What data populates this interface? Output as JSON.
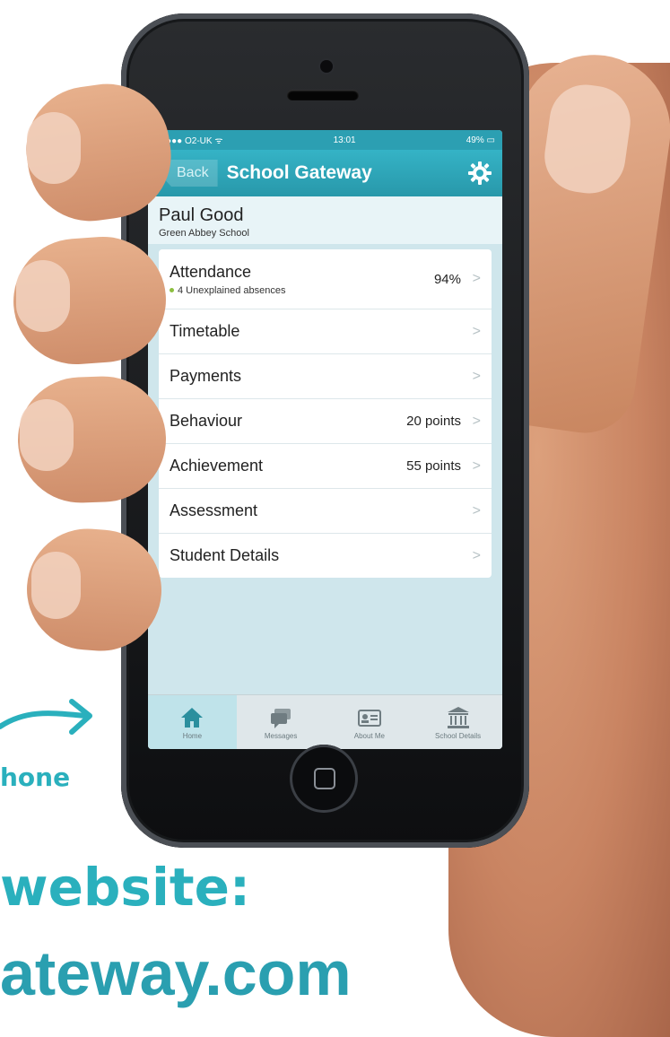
{
  "status_bar": {
    "carrier": "●●●●● O2-UK ᯤ",
    "time": "13:01",
    "battery": "49%"
  },
  "nav": {
    "back_label": "Back",
    "title": "School Gateway",
    "settings_icon": "gear-icon"
  },
  "student": {
    "name": "Paul Good",
    "school": "Green Abbey School"
  },
  "menu": {
    "attendance": {
      "label": "Attendance",
      "value": "94%",
      "sub": "4 Unexplained absences"
    },
    "items": [
      {
        "label": "Timetable",
        "value": ""
      },
      {
        "label": "Payments",
        "value": ""
      },
      {
        "label": "Behaviour",
        "value": "20 points"
      },
      {
        "label": "Achievement",
        "value": "55 points"
      },
      {
        "label": "Assessment",
        "value": ""
      },
      {
        "label": "Student Details",
        "value": ""
      }
    ]
  },
  "tabs": [
    {
      "label": "Home",
      "icon": "home-icon"
    },
    {
      "label": "Messages",
      "icon": "messages-icon"
    },
    {
      "label": "About Me",
      "icon": "id-card-icon"
    },
    {
      "label": "School Details",
      "icon": "school-building-icon"
    }
  ],
  "overlay_text": {
    "phone_fragment": "hone",
    "website_line": "website:",
    "url_line": "ateway.com"
  },
  "colors": {
    "accent": "#2ea9bc",
    "handwriting": "#2ab0bd"
  }
}
